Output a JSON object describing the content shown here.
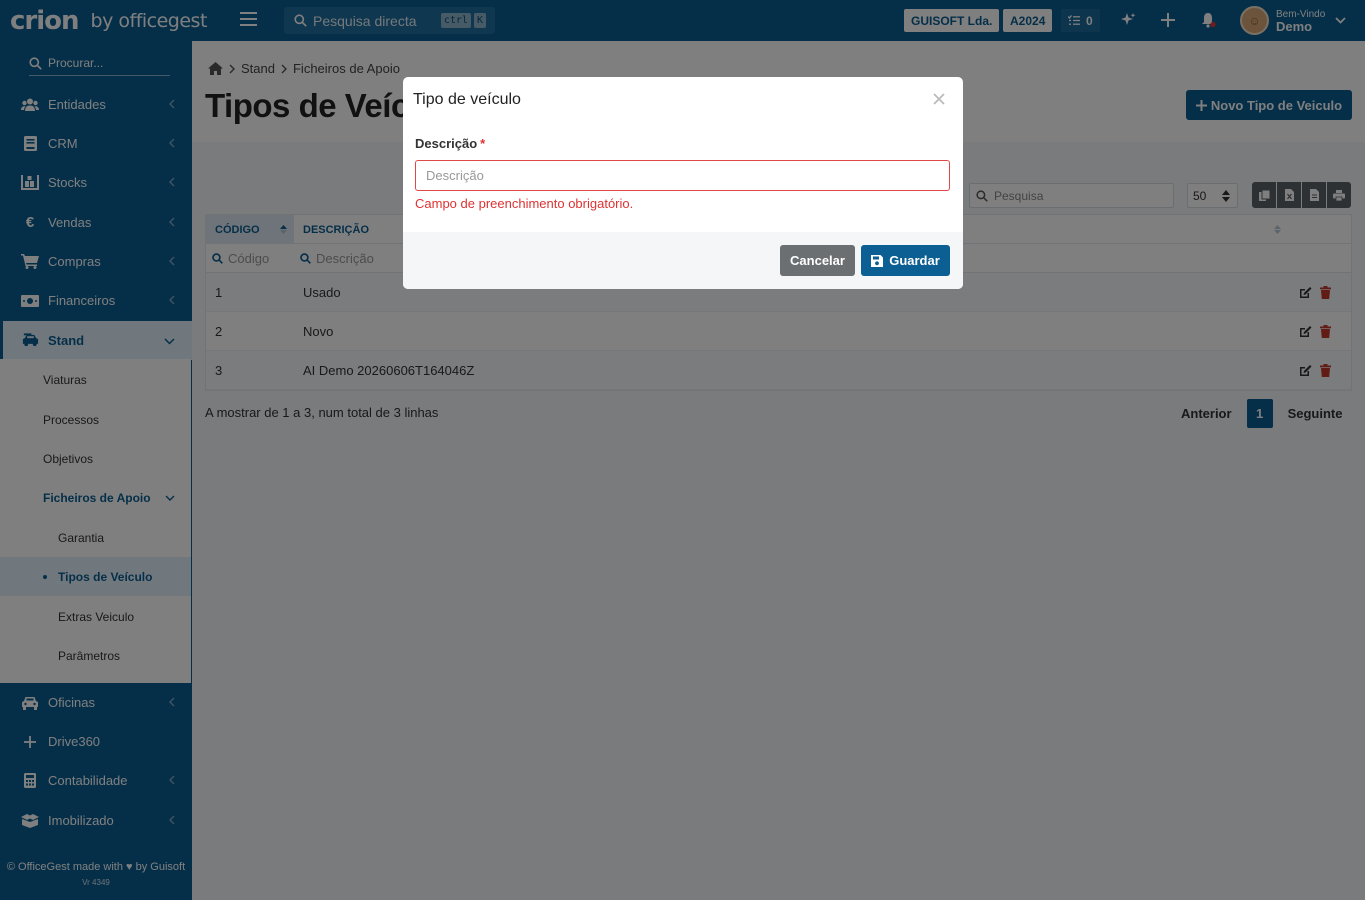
{
  "topbar": {
    "logo_text": "crion",
    "logo_by": "by officegest",
    "quick_search": {
      "placeholder": "Pesquisa directa",
      "shortcut": [
        "ctrl",
        "K"
      ]
    },
    "company": "GUISOFT Lda.",
    "year": "A2024",
    "tasks_count": "0",
    "icons": [
      "sparkle-icon",
      "plus-icon",
      "bell-icon"
    ],
    "user": {
      "greeting": "Bem-Vindo",
      "name": "Demo"
    }
  },
  "sidebar": {
    "search_placeholder": "Procurar...",
    "items_top": [
      {
        "label": "Entidades",
        "icon": "users-icon"
      },
      {
        "label": "CRM",
        "icon": "crm-book-icon"
      },
      {
        "label": "Stocks",
        "icon": "warehouse-icon"
      },
      {
        "label": "Vendas",
        "icon": "euro-icon"
      },
      {
        "label": "Compras",
        "icon": "cart-icon"
      },
      {
        "label": "Financeiros",
        "icon": "money-icon"
      },
      {
        "label": "Stand",
        "icon": "car-stand-icon"
      }
    ],
    "stand_sub": [
      {
        "label": "Viaturas"
      },
      {
        "label": "Processos"
      },
      {
        "label": "Objetivos"
      },
      {
        "label": "Ficheiros de Apoio"
      }
    ],
    "apoio_sub": [
      {
        "label": "Garantia"
      },
      {
        "label": "Tipos de Veículo"
      },
      {
        "label": "Extras Veiculo"
      },
      {
        "label": "Parâmetros"
      }
    ],
    "items_bottom": [
      {
        "label": "Oficinas",
        "icon": "car-icon"
      },
      {
        "label": "Drive360",
        "icon": "plus-icon"
      },
      {
        "label": "Contabilidade",
        "icon": "calculator-icon"
      },
      {
        "label": "Imobilizado",
        "icon": "boxes-icon"
      }
    ],
    "footer": {
      "text": "OfficeGest made with ♥ by Guisoft",
      "version": "Vr 4349"
    }
  },
  "main": {
    "breadcrumb": [
      "Stand",
      "Ficheiros de Apoio"
    ],
    "title": "Tipos de Veículo",
    "new_button": "Novo Tipo de Veiculo",
    "table": {
      "search_placeholder": "Pesquisa",
      "page_size": "50",
      "columns": [
        "CÓDIGO",
        "DESCRIÇÃO"
      ],
      "filters": [
        "Código",
        "Descrição"
      ],
      "rows": [
        {
          "code": "1",
          "description": "Usado"
        },
        {
          "code": "2",
          "description": "Novo"
        },
        {
          "code": "3",
          "description": "AI Demo 20260606T164046Z"
        }
      ],
      "info": "A mostrar de 1 a 3, num total de 3 linhas",
      "pager": {
        "prev": "Anterior",
        "current": "1",
        "next": "Seguinte"
      }
    }
  },
  "modal": {
    "title": "Tipo de veículo",
    "field_label": "Descrição",
    "required_mark": "*",
    "field_placeholder": "Descrição",
    "field_value": "",
    "error": "Campo de preenchimento obrigatório.",
    "cancel": "Cancelar",
    "save": "Guardar"
  },
  "colors": {
    "brand": "#0b5f92",
    "error": "#d33333",
    "delete": "#c0392b"
  }
}
